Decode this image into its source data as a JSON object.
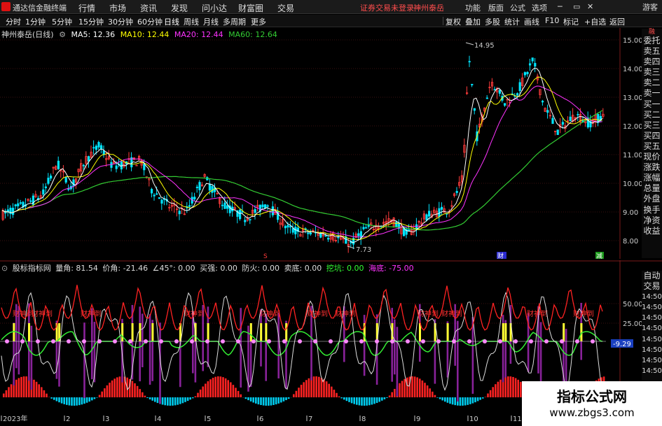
{
  "menubar": {
    "app_title": "通达信金融终端",
    "menus": [
      "行情",
      "市场",
      "资讯",
      "发现",
      "问小达",
      "财富圈",
      "交易"
    ],
    "notice": "证券交易未登录",
    "notice_stock": "神州泰岳",
    "right_menus": [
      "功能",
      "版面",
      "公式",
      "选项"
    ],
    "guest": "游客"
  },
  "toolbar": {
    "periods": [
      "分时",
      "1分钟",
      "5分钟",
      "15分钟",
      "30分钟",
      "60分钟",
      "日线",
      "周线",
      "月线",
      "多周期",
      "更多"
    ],
    "active_period": "日线",
    "right_buttons": [
      "复权",
      "叠加",
      "多股",
      "统计",
      "画线",
      "F10",
      "标记",
      "+自选",
      "返回"
    ]
  },
  "main_legend": {
    "stock": "神州泰岳(日线)",
    "ma5": "MA5: 12.36",
    "ma10": "MA10: 12.44",
    "ma20": "MA20: 12.44",
    "ma60": "MA60: 12.64"
  },
  "colors": {
    "up": "#ff3b3b",
    "down": "#00e5ff",
    "ma5": "#ffffff",
    "ma10": "#ffff00",
    "ma20": "#ff33ff",
    "ma60": "#33cc33",
    "grid": "#3a1010"
  },
  "price_axis": {
    "ticks": [
      "15.00",
      "14.00",
      "13.00",
      "12.00",
      "11.00",
      "10.00",
      "9.00",
      "8.00"
    ]
  },
  "annotations": {
    "high": "14.95",
    "low": "7.73",
    "marker_s": "S",
    "marker_cai": "财",
    "marker_jian": "减"
  },
  "indicator_legend": {
    "name": "股标指标网",
    "vol_angle": "量角: 81.54",
    "price_angle": "价角: -21.46",
    "d45": "∠45°: 0.00",
    "buy_strong": "买强: 0.00",
    "defense": "防火: 0.00",
    "sell_point": "卖底: 0.00",
    "catch": "挖坑: 0.00",
    "sea_bottom": "海底: -75.00"
  },
  "ind_axis": {
    "ticks": [
      "50.00",
      "25.00",
      "-9.29"
    ]
  },
  "ind_labels": [
    "财神到",
    "财神到",
    "财神到",
    "财神到",
    "财神到",
    "财神到",
    "财神到",
    "财神到",
    "财神到",
    "财神到",
    "财神到"
  ],
  "date_axis": [
    "2023年",
    "2",
    "3",
    "4",
    "5",
    "6",
    "7",
    "8",
    "9",
    "10",
    "11"
  ],
  "right_panel_top": [
    "委托",
    "卖五",
    "卖四",
    "卖三",
    "卖二",
    "卖一",
    "买一",
    "买二",
    "买三",
    "买四",
    "买五",
    "现价",
    "涨跌",
    "涨幅",
    "总量",
    "外盘",
    "换手",
    "净资",
    "收益"
  ],
  "right_panel_bottom": [
    "自动",
    "交易",
    "14:50",
    "14:50",
    "14:50",
    "14:50",
    "14:50",
    "14:50",
    "14:50",
    "14:50",
    "14:50"
  ],
  "side_tag": "融",
  "watermark": {
    "title": "指标公式网",
    "url": "www.zbgs3.com"
  }
}
